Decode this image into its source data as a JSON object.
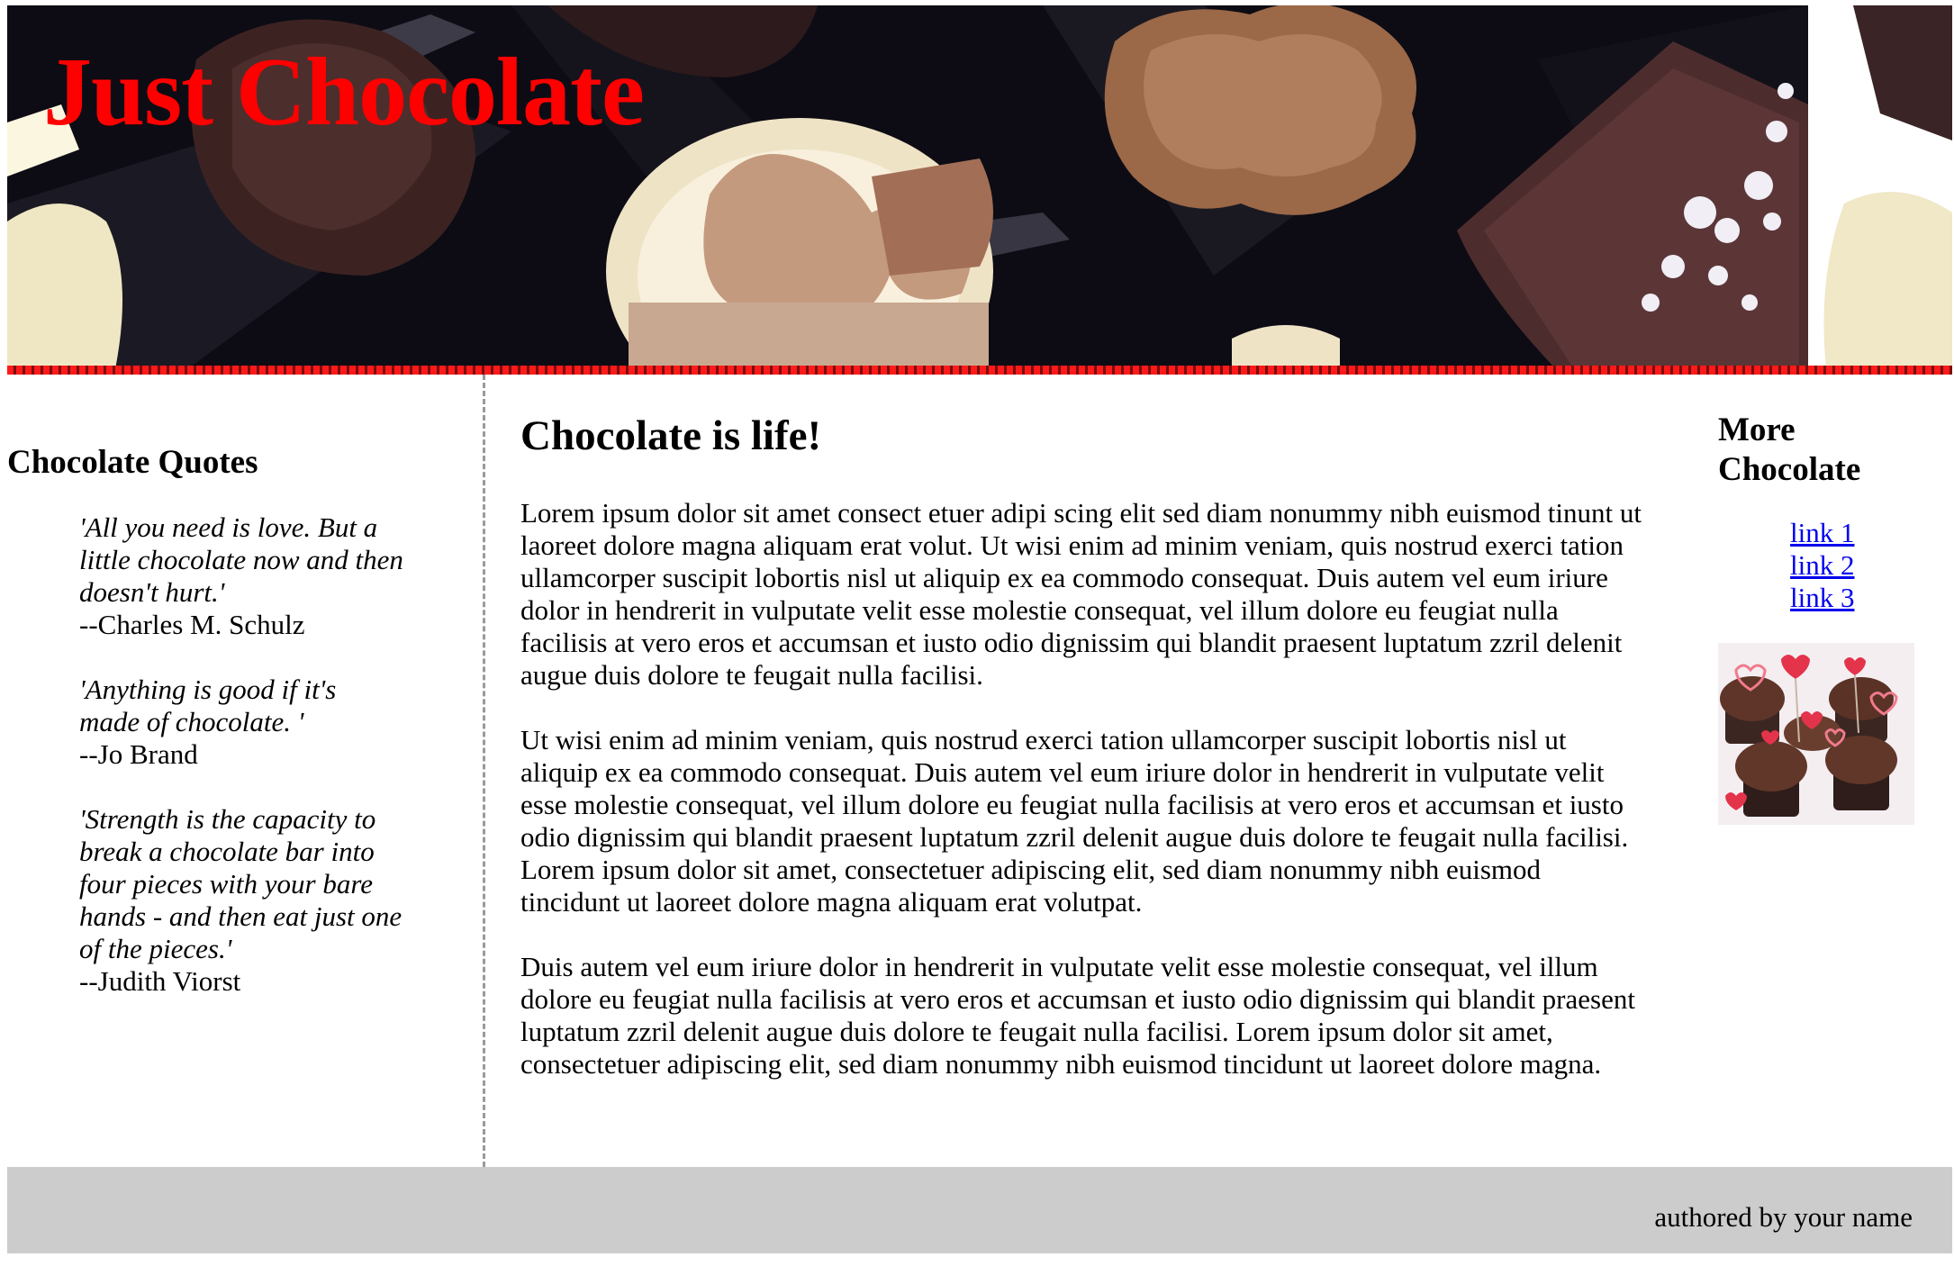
{
  "header": {
    "title": "Just Chocolate",
    "title_color": "#ff0000",
    "background_image": "box-of-assorted-chocolates"
  },
  "sidebar_left": {
    "heading": "Chocolate Quotes",
    "quotes": [
      {
        "text": "'All you need is love. But a little chocolate now and then doesn't hurt.'",
        "author": "--Charles M. Schulz"
      },
      {
        "text": "'Anything is good if it's made of chocolate. '",
        "author": "--Jo Brand"
      },
      {
        "text": "'Strength is the capacity to break a chocolate bar into four pieces with your bare hands - and then eat just one of the pieces.'",
        "author": "--Judith Viorst"
      }
    ]
  },
  "main": {
    "heading": "Chocolate is life!",
    "paragraphs": [
      "Lorem ipsum dolor sit amet consect etuer adipi scing elit sed diam nonummy nibh euismod tinunt ut laoreet dolore magna aliquam erat volut. Ut wisi enim ad minim veniam, quis nostrud exerci tation ullamcorper suscipit lobortis nisl ut aliquip ex ea commodo consequat. Duis autem vel eum iriure dolor in hendrerit in vulputate velit esse molestie consequat, vel illum dolore eu feugiat nulla facilisis at vero eros et accumsan et iusto odio dignissim qui blandit praesent luptatum zzril delenit augue duis dolore te feugait nulla facilisi.",
      "Ut wisi enim ad minim veniam, quis nostrud exerci tation ullamcorper suscipit lobortis nisl ut aliquip ex ea commodo consequat. Duis autem vel eum iriure dolor in hendrerit in vulputate velit esse molestie consequat, vel illum dolore eu feugiat nulla facilisis at vero eros et accumsan et iusto odio dignissim qui blandit praesent luptatum zzril delenit augue duis dolore te feugait nulla facilisi. Lorem ipsum dolor sit amet, consectetuer adipiscing elit, sed diam nonummy nibh euismod tincidunt ut laoreet dolore magna aliquam erat volutpat.",
      "Duis autem vel eum iriure dolor in hendrerit in vulputate velit esse molestie consequat, vel illum dolore eu feugiat nulla facilisis at vero eros et accumsan et iusto odio dignissim qui blandit praesent luptatum zzril delenit augue duis dolore te feugait nulla facilisi. Lorem ipsum dolor sit amet, consectetuer adipiscing elit, sed diam nonummy nibh euismod tincidunt ut laoreet dolore magna."
    ]
  },
  "sidebar_right": {
    "heading": "More Chocolate",
    "links": [
      "link 1",
      "link 2",
      "link 3"
    ],
    "link_color": "#0000ee",
    "image": "chocolate-cupcakes-with-hearts"
  },
  "footer": {
    "text": "authored by your name",
    "background": "#cccccc"
  }
}
